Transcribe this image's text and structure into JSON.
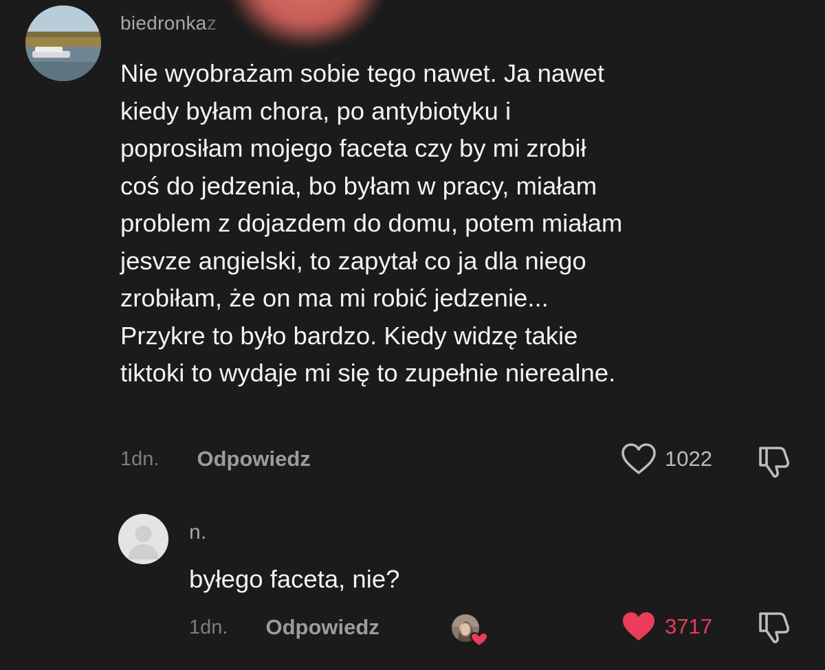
{
  "comments": [
    {
      "username": "biedronka",
      "username_fade": "z",
      "lines": [
        "Nie wyobrażam sobie tego nawet. Ja nawet",
        "kiedy byłam chora, po antybiotyku i",
        "poprosiłam mojego faceta czy by mi zrobił",
        "coś do jedzenia, bo byłam w pracy, miałam",
        "problem z dojazdem do domu, potem miałam",
        "jesvze angielski, to zapytał co ja dla niego",
        "zrobiłam, że on ma mi robić jedzenie...",
        "Przykre to było bardzo. Kiedy widzę takie",
        "tiktoki to wydaje mi się to zupełnie nierealne."
      ],
      "time": "1dn.",
      "reply_label": "Odpowiedz",
      "like_count": "1022",
      "liked": false
    },
    {
      "username": "n.",
      "text": "byłego faceta, nie?",
      "time": "1dn.",
      "reply_label": "Odpowiedz",
      "like_count": "3717",
      "liked": true,
      "liked_by_creator": true
    }
  ],
  "colors": {
    "background": "#1b1b1b",
    "text": "#f3f3f3",
    "muted": "#9c9c9c",
    "like_active": "#ea3c5b"
  },
  "icons": {
    "like": "heart-outline-icon",
    "like_active": "heart-filled-icon",
    "dislike": "thumbs-down-icon"
  }
}
